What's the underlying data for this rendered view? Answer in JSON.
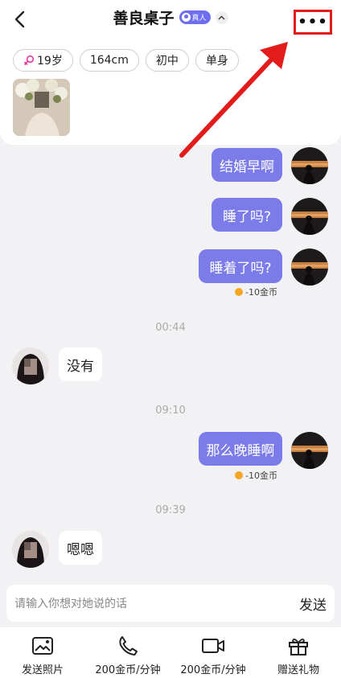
{
  "header": {
    "back_icon": "chevron-left-icon",
    "title": "善良桌子",
    "verify_badge": "真人",
    "more_label": "•••"
  },
  "profile": {
    "tags": [
      {
        "label": "19岁",
        "icon": "female-icon"
      },
      {
        "label": "164cm"
      },
      {
        "label": "初中"
      },
      {
        "label": "单身"
      }
    ]
  },
  "messages": [
    {
      "from": "me",
      "text": "结婚早啊"
    },
    {
      "from": "me",
      "text": "睡了吗?"
    },
    {
      "from": "me",
      "text": "睡着了吗?",
      "cost": "-10金币"
    },
    {
      "time": "00:44"
    },
    {
      "from": "her",
      "text": "没有"
    },
    {
      "time": "09:10"
    },
    {
      "from": "me",
      "text": "那么晚睡啊",
      "cost": "-10金币"
    },
    {
      "time": "09:39"
    },
    {
      "from": "her",
      "text": "嗯嗯"
    }
  ],
  "input": {
    "placeholder": "请输入你想对她说的话",
    "send_label": "发送"
  },
  "toolbar": [
    {
      "label": "发送照片",
      "icon": "photo-icon"
    },
    {
      "label": "200金币/分钟",
      "icon": "phone-icon"
    },
    {
      "label": "200金币/分钟",
      "icon": "video-icon"
    },
    {
      "label": "赠送礼物",
      "icon": "gift-icon"
    }
  ],
  "colors": {
    "accent": "#7b7bea",
    "annotation": "#e31b1b",
    "female": "#e23b9e",
    "coin": "#f5a623"
  }
}
